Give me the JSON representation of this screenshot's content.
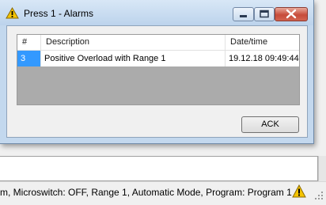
{
  "dialog": {
    "title": "Press 1 - Alarms",
    "columns": [
      "#",
      "Description",
      "Date/time"
    ],
    "rows": [
      {
        "num": "3",
        "description": "Positive Overload with Range 1",
        "datetime": "19.12.18 09:49:44"
      }
    ],
    "ack_label": "ACK"
  },
  "status_bar": {
    "text": "m, Microswitch: OFF, Range 1, Automatic Mode, Program: Program 1"
  },
  "colors": {
    "selection": "#3399ff",
    "title_bar": "#c3d8ee",
    "close_button": "#c74c3a",
    "warning": "#f5c400"
  },
  "icons": [
    "warning-icon",
    "minimize-icon",
    "maximize-icon",
    "close-icon",
    "resize-grip-icon"
  ]
}
